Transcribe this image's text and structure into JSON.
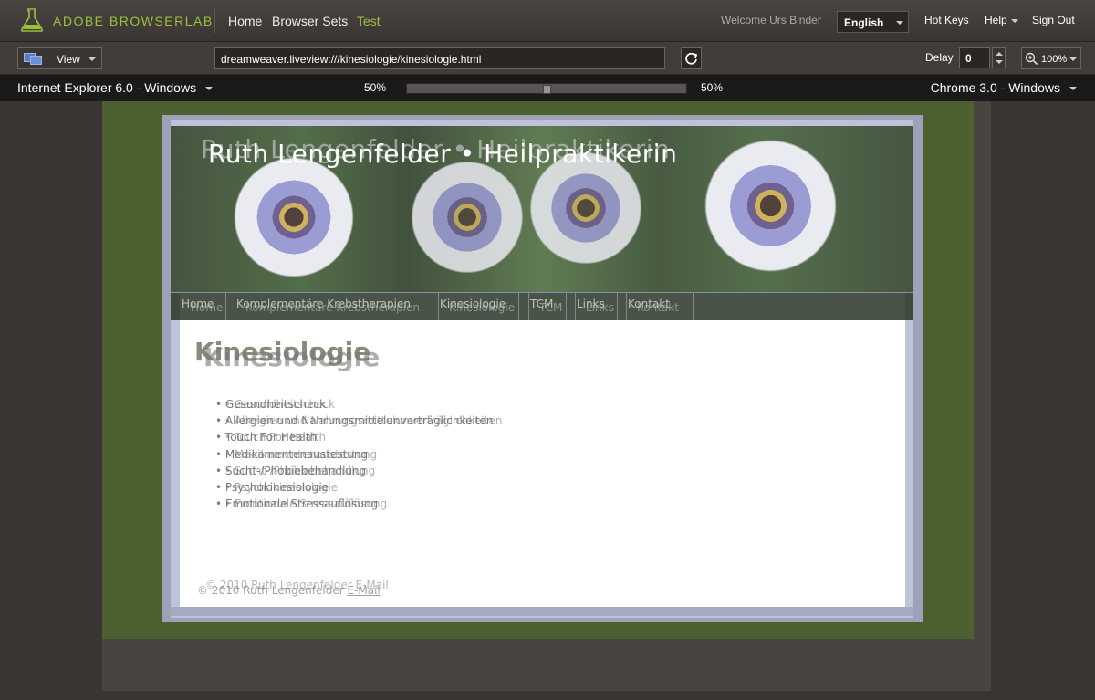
{
  "app": {
    "brand": "ADOBE BROWSERLAB",
    "nav": {
      "home": "Home",
      "browser_sets": "Browser Sets",
      "test": "Test"
    },
    "welcome": "Welcome Urs Binder",
    "language": "English",
    "hot_keys": "Hot Keys",
    "help": "Help",
    "sign_out": "Sign Out",
    "accent_color": "#9bc13a"
  },
  "toolbar": {
    "view_label": "View",
    "url": "dreamweaver.liveview:///kinesiologie/kinesiologie.html",
    "delay_label": "Delay",
    "delay_value": "0",
    "zoom": "100%"
  },
  "browsers": {
    "left": "Internet Explorer 6.0 - Windows",
    "right": "Chrome 3.0 - Windows",
    "left_opacity": "50%",
    "right_opacity": "50%",
    "onion_skin_fraction": 0.5
  },
  "site": {
    "title": "Ruth Lengenfelder • Heilpraktikerin",
    "menu": [
      "Home",
      "Komplementäre Krebstherapien",
      "Kinesiologie",
      "TCM",
      "Links",
      "Kontakt"
    ],
    "heading": "Kinesiologie",
    "list": [
      "Gesundheitscheck",
      "Allergien und Nahrungsmittelunverträglichkeiten",
      "Touch For Health",
      "Medikamentenaustestung",
      "Sucht-/Phobiebehandlung",
      "Psychokinesiologie",
      "Emotionale Stressauflösung"
    ],
    "footer_text": "© 2010 Ruth Lengenfelder",
    "footer_link": "E-Mail"
  }
}
